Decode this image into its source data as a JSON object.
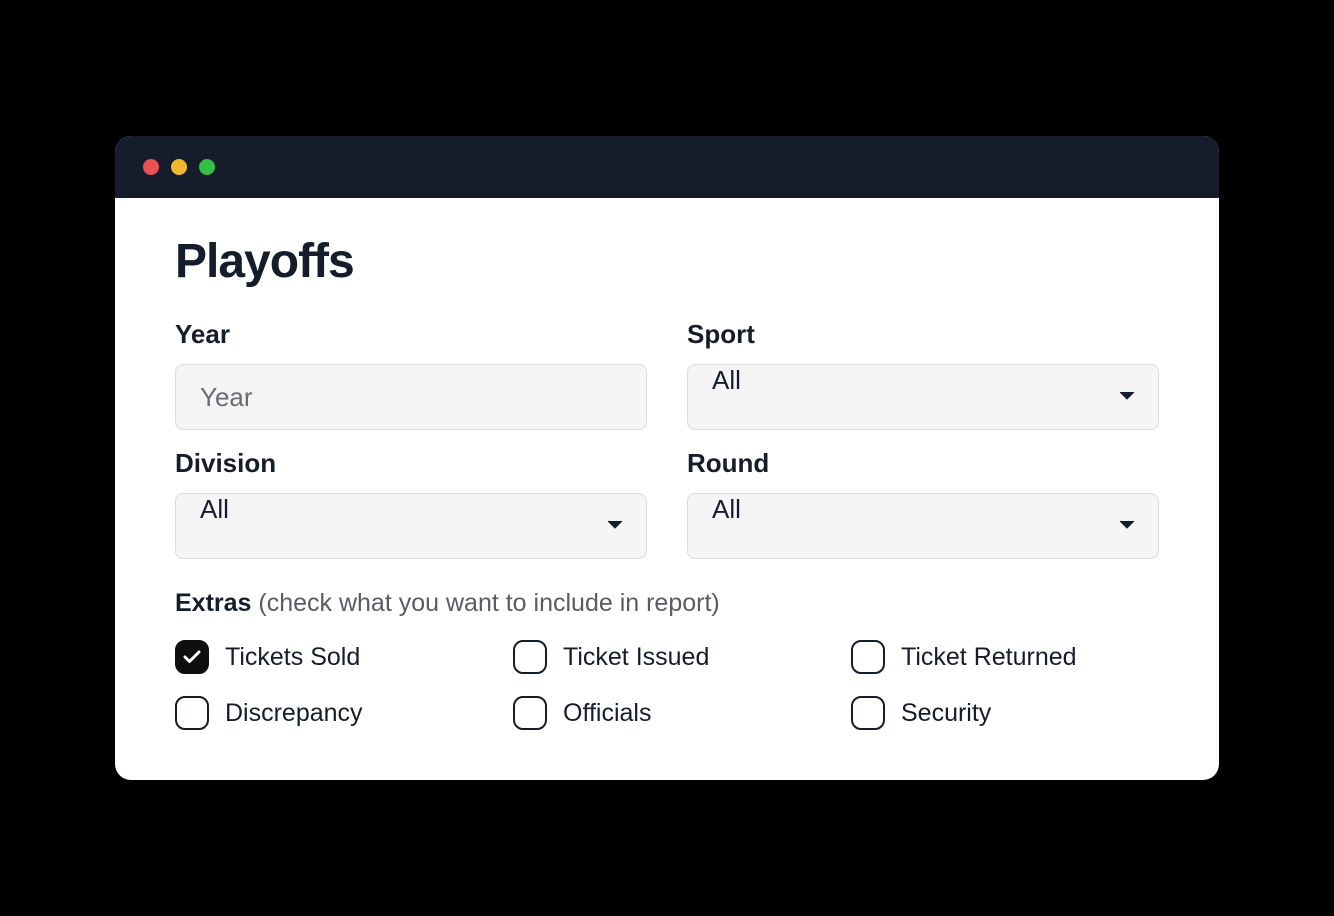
{
  "title": "Playoffs",
  "fields": {
    "year": {
      "label": "Year",
      "placeholder": "Year"
    },
    "sport": {
      "label": "Sport",
      "value": "All"
    },
    "division": {
      "label": "Division",
      "value": "All"
    },
    "round": {
      "label": "Round",
      "value": "All"
    }
  },
  "extras": {
    "label": "Extras",
    "note": " (check what you want to include in report)",
    "options": [
      {
        "label": "Tickets Sold",
        "checked": true
      },
      {
        "label": "Ticket Issued",
        "checked": false
      },
      {
        "label": "Ticket Returned",
        "checked": false
      },
      {
        "label": "Discrepancy",
        "checked": false
      },
      {
        "label": "Officials",
        "checked": false
      },
      {
        "label": "Security",
        "checked": false
      }
    ]
  }
}
